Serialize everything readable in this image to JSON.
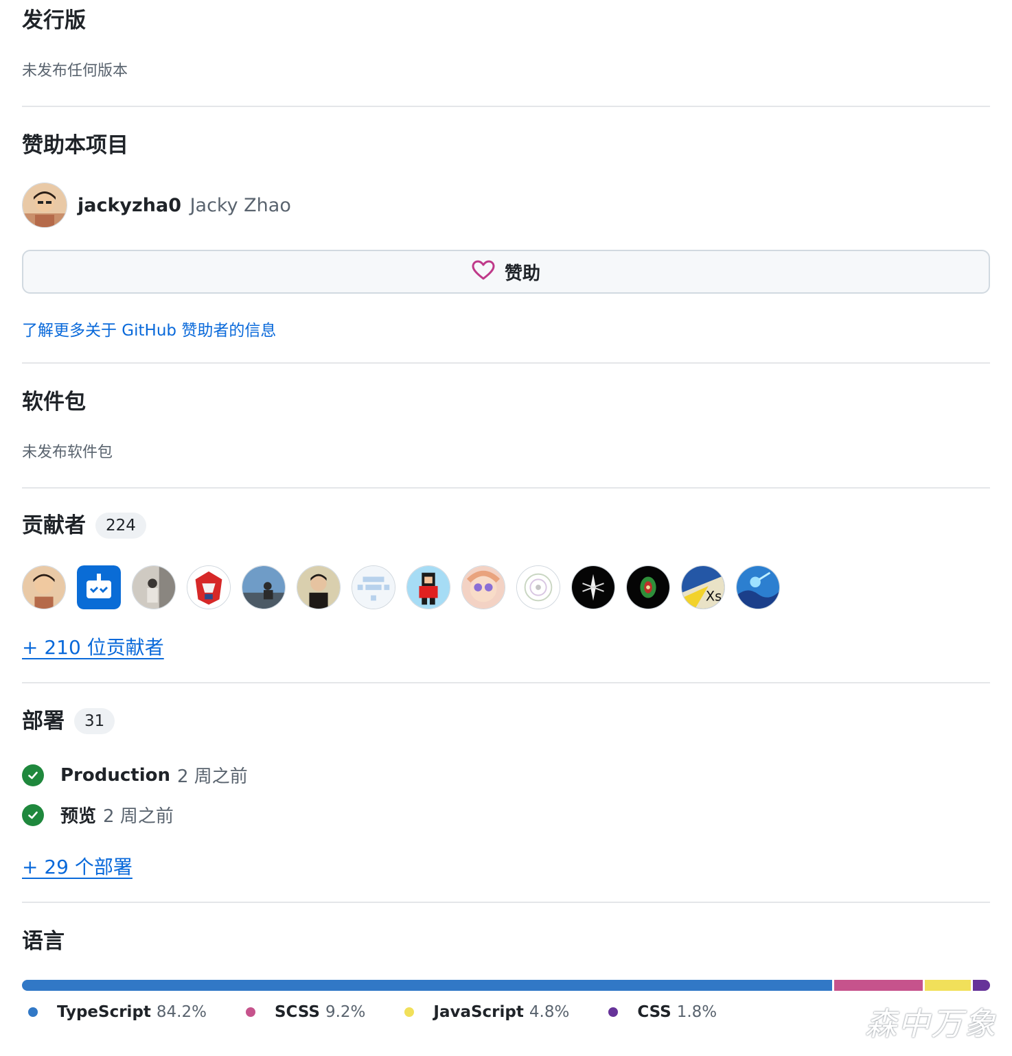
{
  "releases": {
    "title": "发行版",
    "empty": "未发布任何版本"
  },
  "sponsor": {
    "title": "赞助本项目",
    "username": "jackyzha0",
    "fullname": "Jacky Zhao",
    "button_label": "赞助",
    "learn_more": "了解更多关于 GitHub 赞助者的信息"
  },
  "packages": {
    "title": "软件包",
    "empty": "未发布软件包"
  },
  "contributors": {
    "title": "贡献者",
    "count": "224",
    "more_link": "+ 210 位贡献者"
  },
  "deployments": {
    "title": "部署",
    "count": "31",
    "items": [
      {
        "name": "Production",
        "time": "2 周之前"
      },
      {
        "name": "预览",
        "time": "2 周之前"
      }
    ],
    "more_link": "+ 29 个部署"
  },
  "languages": {
    "title": "语言",
    "items": [
      {
        "name": "TypeScript",
        "percent": "84.2%",
        "value": 84.2,
        "color": "#3178c6"
      },
      {
        "name": "SCSS",
        "percent": "9.2%",
        "value": 9.2,
        "color": "#c6538c"
      },
      {
        "name": "JavaScript",
        "percent": "4.8%",
        "value": 4.8,
        "color": "#f1e05a"
      },
      {
        "name": "CSS",
        "percent": "1.8%",
        "value": 1.8,
        "color": "#663399"
      }
    ]
  },
  "watermark": "森中万象"
}
